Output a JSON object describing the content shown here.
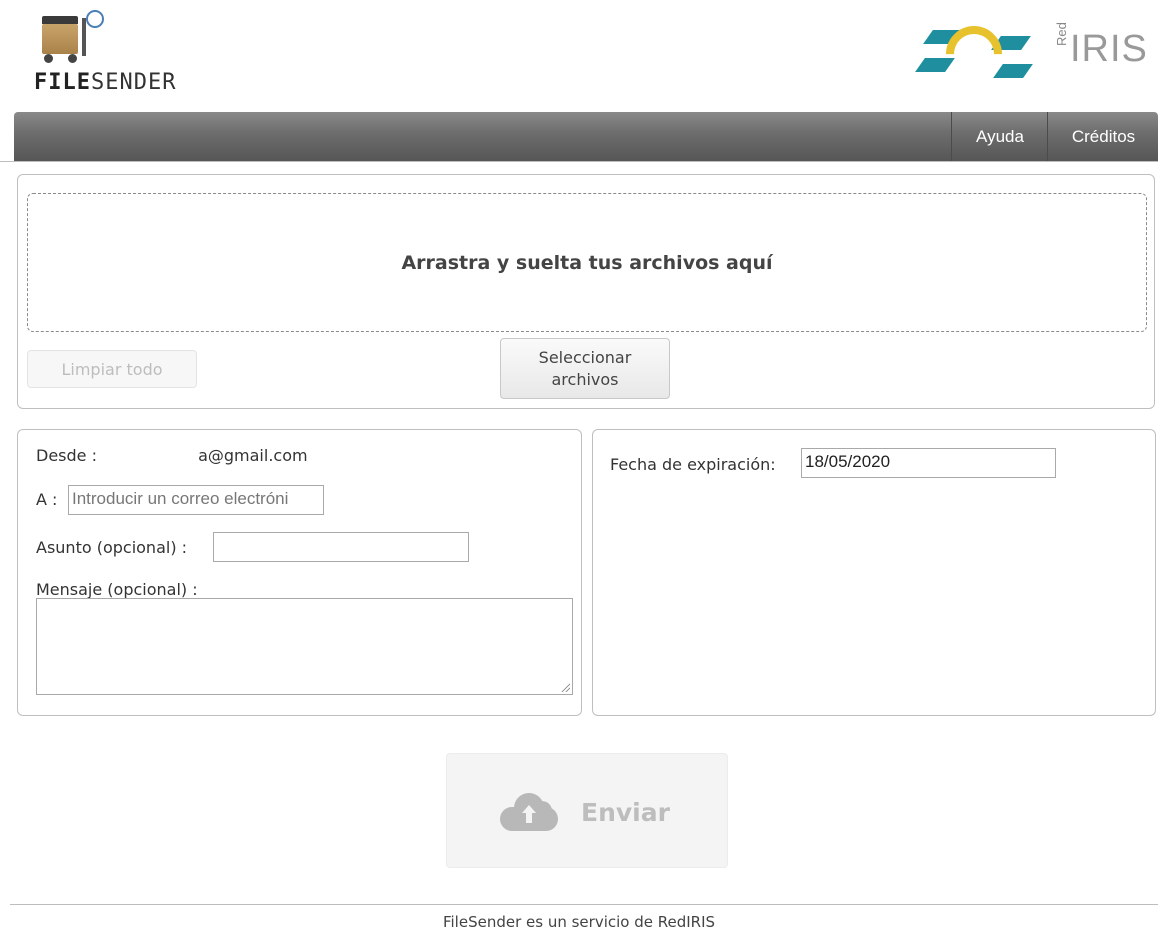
{
  "header": {
    "logo_text_bold": "FILE",
    "logo_text_normal": "SENDER",
    "partner_small": "Red",
    "partner_large": "IRIS"
  },
  "nav": {
    "items": [
      {
        "label": "Ayuda"
      },
      {
        "label": "Créditos"
      }
    ]
  },
  "upload": {
    "drop_text": "Arrastra y suelta tus archivos aquí",
    "clear_label": "Limpiar todo",
    "select_label_line1": "Seleccionar",
    "select_label_line2": "archivos"
  },
  "form": {
    "from_label": "Desde :",
    "from_value": "a@gmail.com",
    "to_label": "A :",
    "to_placeholder": "Introducir un correo electróni",
    "subject_label": "Asunto (opcional) :",
    "subject_value": "",
    "message_label": "Mensaje (opcional) :",
    "message_value": ""
  },
  "options": {
    "expiry_label": "Fecha de expiración:",
    "expiry_value": "18/05/2020"
  },
  "send": {
    "label": "Enviar"
  },
  "footer": {
    "text": "FileSender es un servicio de RedIRIS"
  },
  "colors": {
    "navbar": "#6e6e6e",
    "partner_teal": "#1f8fa0",
    "partner_yellow": "#e8c22c"
  }
}
